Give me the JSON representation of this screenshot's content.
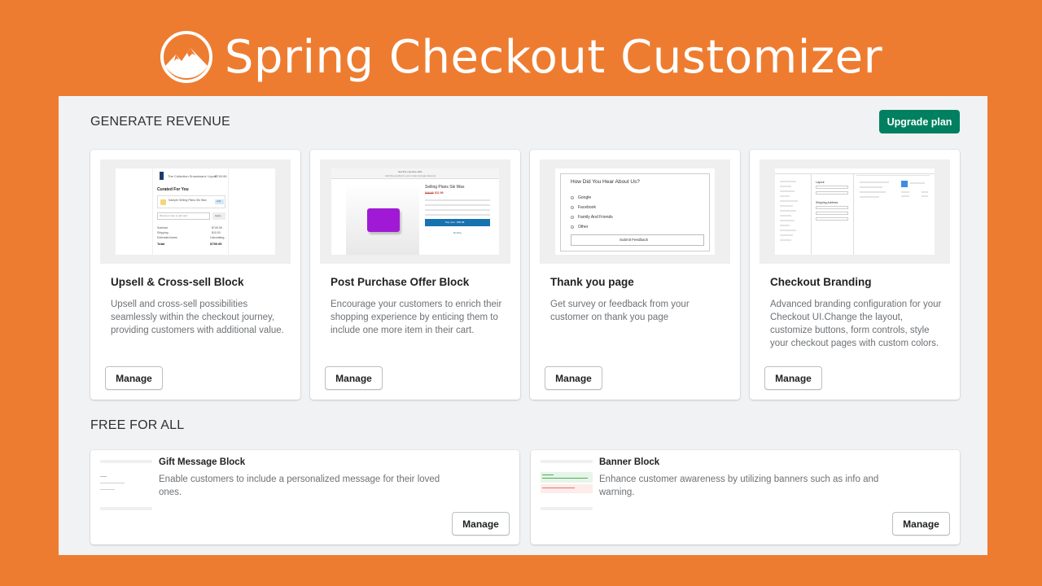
{
  "banner": {
    "title": "Spring Checkout Customizer",
    "logo_icon": "mountain-circle-logo-icon"
  },
  "sections": {
    "generate_revenue": "GENERATE REVENUE",
    "free_for_all": "FREE FOR ALL"
  },
  "header": {
    "upgrade_label": "Upgrade plan"
  },
  "colors": {
    "background": "#ee7c30",
    "panel": "#f1f2f4",
    "primary": "#008060"
  },
  "cards": [
    {
      "title": "Upsell & Cross-sell Block",
      "description": "Upsell and cross-sell possibilities seamlessly within the checkout journey, providing customers with additional value.",
      "manage_label": "Manage",
      "preview": {
        "store": "The Collection Snowboard: Liquid",
        "price": "$749.95",
        "heading": "Curated For You",
        "product": "Sample Selling Plans Ski Wax",
        "add": "Add",
        "discount_placeholder": "Discount code or gift card",
        "apply": "Apply",
        "rows": [
          {
            "label": "Subtotal",
            "value": "$749.95"
          },
          {
            "label": "Shipping",
            "value": "$10.00"
          },
          {
            "label": "Estimated taxes",
            "value": "Calculating..."
          },
          {
            "label": "Total",
            "value": "$759.95"
          }
        ]
      }
    },
    {
      "title": "Post Purchase Offer Block",
      "description": "Encourage your customers to enrich their shopping experience by enticing them to include one more item in their cart.",
      "manage_label": "Manage",
      "preview": {
        "banner_line1": "Get this one-time offer",
        "banner_line2": "Add this product to your order and get discount",
        "product": "Selling Plans Ski Wax",
        "old_price": "$49.95",
        "new_price": "$11.96",
        "pay_label": "Pay now · $59.98",
        "decline_label": "Decline"
      }
    },
    {
      "title": "Thank you page",
      "description": "Get survey or feedback from your customer on thank you page",
      "manage_label": "Manage",
      "preview": {
        "question": "How Did You Hear About Us?",
        "options": [
          "Google",
          "Facebook",
          "Family And Friends",
          "Other"
        ],
        "submit": "Submit Feedback"
      }
    },
    {
      "title": "Checkout Branding",
      "description": "Advanced branding configuration for your Checkout UI.Change the layout, customize buttons, form controls, style your checkout pages with custom colors.",
      "manage_label": "Manage",
      "preview": {
        "section1": "Layout",
        "section2": "Shipping Address"
      }
    }
  ],
  "free_cards": [
    {
      "title": "Gift Message Block",
      "description": "Enable customers to include a personalized message for their loved ones.",
      "manage_label": "Manage"
    },
    {
      "title": "Banner Block",
      "description": "Enhance customer awareness by utilizing banners such as info and warning.",
      "manage_label": "Manage"
    }
  ]
}
